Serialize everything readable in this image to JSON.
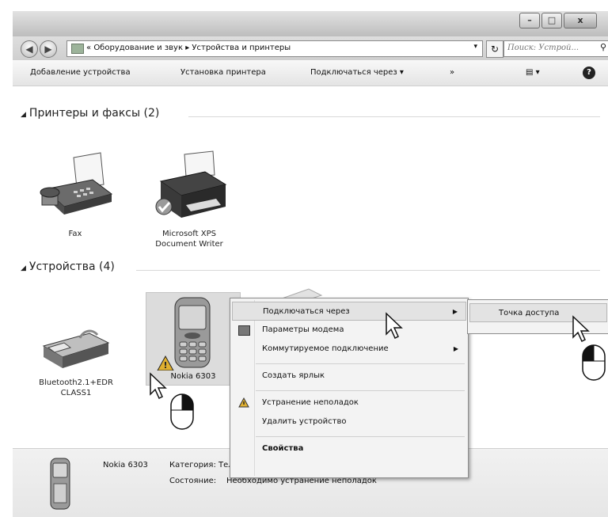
{
  "titlebar": {
    "minimize_icon": "minimize-icon",
    "maximize_icon": "maximize-icon",
    "close_label": "x"
  },
  "nav": {
    "back_glyph": "◀",
    "forward_glyph": "▶",
    "breadcrumb_prefix": "«",
    "breadcrumbs": [
      "Оборудование и звук",
      "Устройства и принтеры"
    ],
    "breadcrumb_sep": "▸",
    "refresh_glyph": "↻",
    "search_placeholder": "Поиск: Устрой...",
    "search_glyph": "⚲"
  },
  "toolbar": {
    "add_device": "Добавление устройства",
    "add_printer": "Установка принтера",
    "connect_via": "Подключаться через ▾",
    "more": "»",
    "view": "▤ ▾",
    "help": "?"
  },
  "groups": {
    "printers": "Принтеры и факсы (2)",
    "devices": "Устройства (4)"
  },
  "printers": [
    {
      "label": "Fax"
    },
    {
      "label": "Microsoft XPS Document Writer"
    }
  ],
  "devices": [
    {
      "label": "Bluetooth2.1+EDR CLASS1"
    },
    {
      "label": "Nokia 6303"
    }
  ],
  "context_menu": {
    "connect_via": "Подключаться через",
    "modem_params": "Параметры модема",
    "dialup": "Коммутируемое подключение",
    "shortcut": "Создать ярлык",
    "troubleshoot": "Устранение неполадок",
    "remove": "Удалить устройство",
    "properties": "Свойства",
    "arrow": "▶"
  },
  "submenu": {
    "access_point": "Точка доступа"
  },
  "details": {
    "name": "Nokia 6303",
    "category_label": "Категория:",
    "category_value": "Телефон",
    "status_label": "Состояние:",
    "status_value": "Необходимо устранение неполадок"
  },
  "colors": {
    "accent": "#9cb39a",
    "warning": "#e0b030"
  }
}
